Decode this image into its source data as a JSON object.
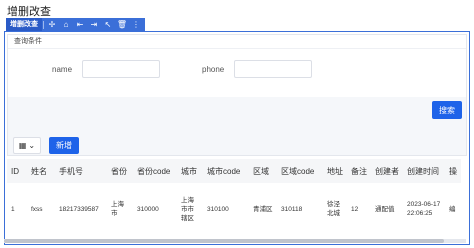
{
  "page_title": "增删改查",
  "toolbar": {
    "label": "增删改查",
    "icons": [
      "move-icon",
      "home-icon",
      "align-left-icon",
      "align-right-icon",
      "pick-icon",
      "delete-icon",
      "more-icon"
    ]
  },
  "search": {
    "header": "查询条件",
    "fields": [
      {
        "label": "name",
        "value": "",
        "placeholder": ""
      },
      {
        "label": "phone",
        "value": "",
        "placeholder": ""
      }
    ],
    "search_label": "搜索"
  },
  "actions": {
    "view_icon": "grid-icon",
    "add_label": "新增"
  },
  "table": {
    "columns": [
      "ID",
      "姓名",
      "手机号",
      "省份",
      "省份code",
      "城市",
      "城市code",
      "区域",
      "区域code",
      "地址",
      "备注",
      "创建者",
      "创建时间",
      "操"
    ],
    "rows": [
      [
        "1",
        "fxss",
        "18217339587",
        "上海市",
        "310000",
        "上海市市辖区",
        "310100",
        "青浦区",
        "310118",
        "徐泾北城",
        "12",
        "通配值",
        "2023-06-17 22:06:25",
        "编"
      ]
    ]
  }
}
